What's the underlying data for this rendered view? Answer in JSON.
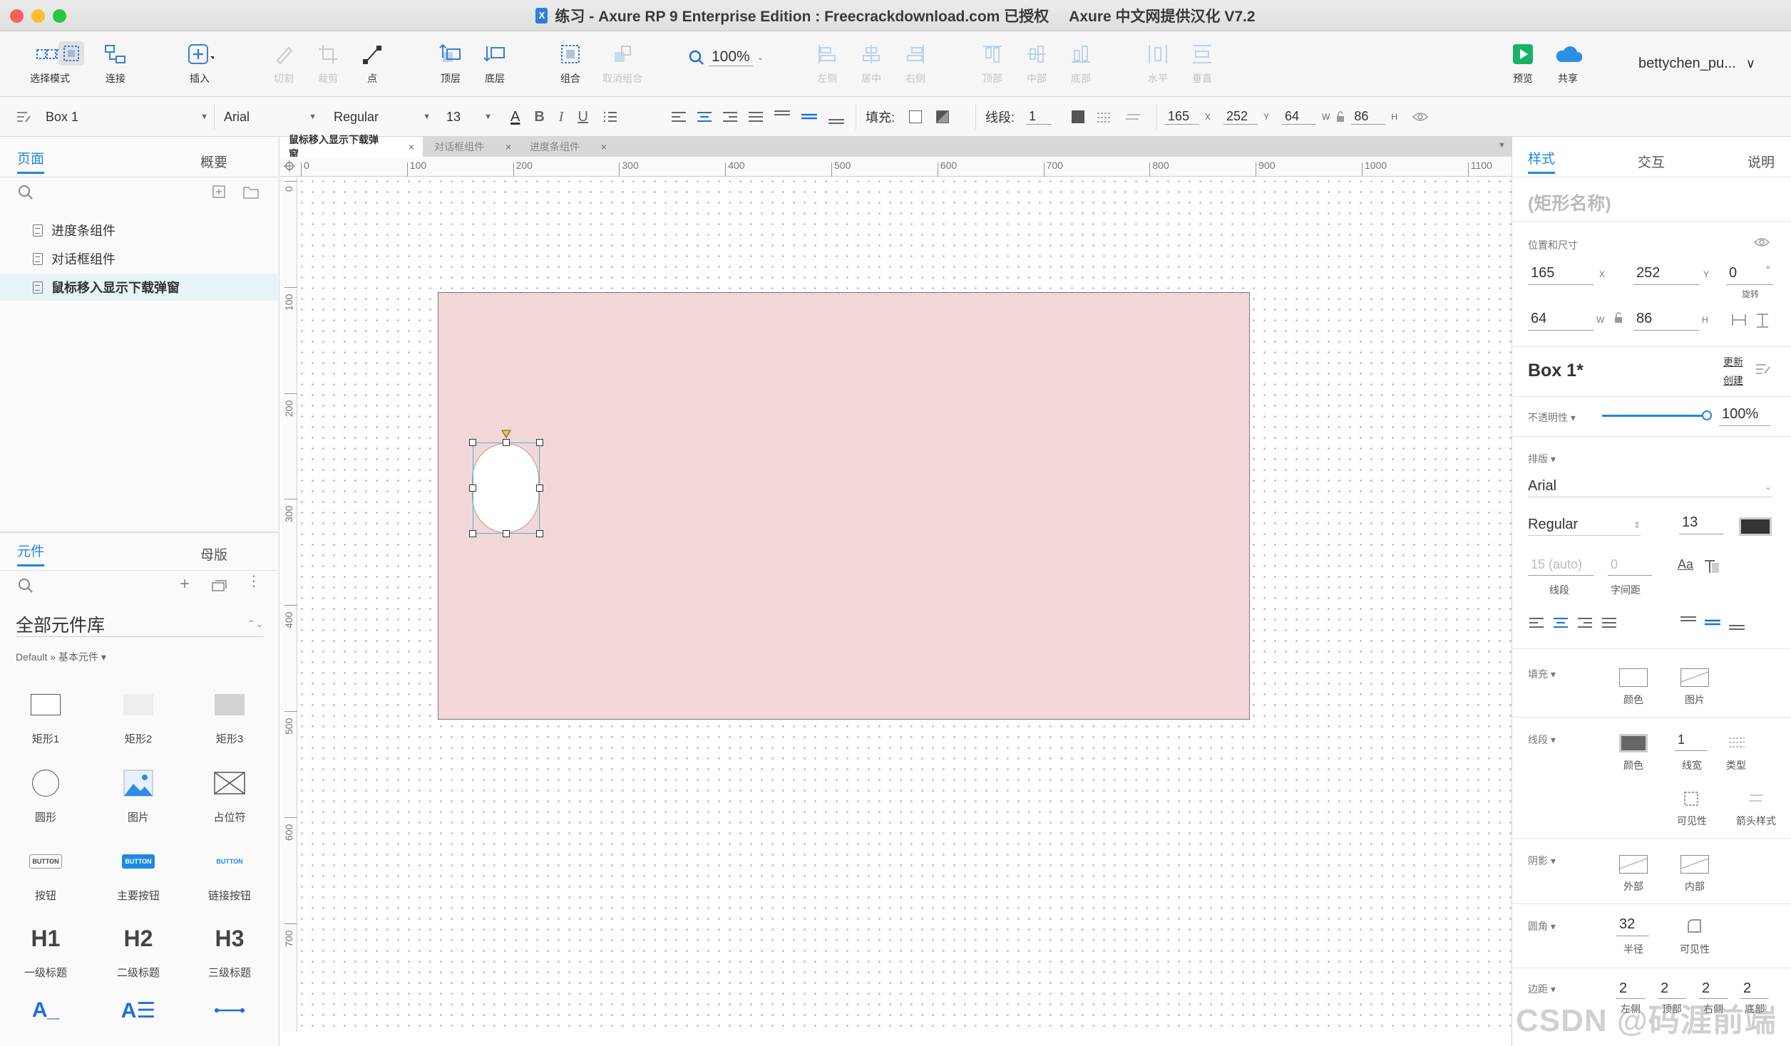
{
  "window": {
    "title": "练习 - Axure RP 9 Enterprise Edition : Freecrackdownload.com 已授权",
    "title_suffix": "Axure 中文网提供汉化 V7.2",
    "badge": "X"
  },
  "toolbar": {
    "select_mode": "选择模式",
    "connect": "连接",
    "insert": "插入",
    "cut": "切割",
    "crop": "裁剪",
    "point": "点",
    "top": "顶层",
    "bottom": "底层",
    "group": "组合",
    "ungroup": "取消组合",
    "zoom": "100%",
    "align_left": "左侧",
    "align_center": "居中",
    "align_right": "右侧",
    "align_top": "顶部",
    "align_middle": "中部",
    "align_bottom": "底部",
    "dist_h": "水平",
    "dist_v": "垂直",
    "preview": "预览",
    "share": "共享",
    "user": "bettychen_pu..."
  },
  "formatbar": {
    "widget_name": "Box 1",
    "font": "Arial",
    "weight": "Regular",
    "size": "13",
    "fill_label": "填充:",
    "stroke_label": "线段:",
    "stroke_width": "1",
    "x": "165",
    "y": "252",
    "w": "64",
    "h": "86",
    "x_unit": "X",
    "y_unit": "Y",
    "w_unit": "W",
    "h_unit": "H"
  },
  "left": {
    "tabs": [
      "页面",
      "概要"
    ],
    "pages": [
      "进度条组件",
      "对话框组件",
      "鼠标移入显示下载弹窗"
    ],
    "lib_tabs": [
      "元件",
      "母版"
    ],
    "library": "全部元件库",
    "library_sub": "Default » 基本元件 ▾",
    "widgets": [
      "矩形1",
      "矩形2",
      "矩形3",
      "圆形",
      "图片",
      "占位符",
      "按钮",
      "主要按钮",
      "链接按钮",
      "一级标题",
      "二级标题",
      "三级标题"
    ],
    "button_text": "BUTTON",
    "headings": [
      "H1",
      "H2",
      "H3"
    ],
    "text_icons": [
      "A_",
      "A☰"
    ]
  },
  "canvas": {
    "doc_tabs": [
      "鼠标移入显示下载弹窗",
      "对话框组件",
      "进度条组件"
    ],
    "h_ticks": [
      "0",
      "100",
      "200",
      "300",
      "400",
      "500",
      "600",
      "700",
      "800",
      "900",
      "1000",
      "1100"
    ],
    "v_ticks": [
      "0",
      "100",
      "200",
      "300",
      "400",
      "500",
      "600",
      "700"
    ],
    "colors": {
      "box_fill": "#f3d6d8",
      "grid_dot": "#8b8ef0",
      "selection": "#3cc0c8"
    }
  },
  "right": {
    "tabs": [
      "样式",
      "交互",
      "说明"
    ],
    "shape_name_placeholder": "(矩形名称)",
    "pos_size_label": "位置和尺寸",
    "x": "165",
    "y": "252",
    "rotation": "0",
    "rotation_unit": "°",
    "rotation_label": "旋转",
    "w": "64",
    "h": "86",
    "x_unit": "X",
    "y_unit": "Y",
    "w_unit": "W",
    "h_unit": "H",
    "style_name": "Box 1*",
    "update": "更新",
    "create": "创建",
    "opacity_label": "不透明性 ▾",
    "opacity": "100%",
    "typography_label": "排版 ▾",
    "font": "Arial",
    "weight": "Regular",
    "size": "13",
    "line_height": "15 (auto)",
    "line_height_label": "线段",
    "letter_spacing": "0",
    "letter_spacing_label": "字间距",
    "text_case": "Aa",
    "fill_label": "填充 ▾",
    "fill_color": "颜色",
    "fill_image": "图片",
    "stroke_label": "线段 ▾",
    "stroke_color": "颜色",
    "stroke_width": "1",
    "stroke_width_label": "线宽",
    "stroke_type": "类型",
    "visibility": "可见性",
    "arrow_style": "箭头样式",
    "shadow_label": "阴影 ▾",
    "shadow_outer": "外部",
    "shadow_inner": "内部",
    "corner_label": "圆角 ▾",
    "corner_radius": "32",
    "corner_radius_label": "半径",
    "corner_visibility": "可见性",
    "padding_label": "边距 ▾",
    "padding": [
      "2",
      "2",
      "2",
      "2"
    ],
    "padding_labels": [
      "左侧",
      "顶部",
      "右侧",
      "底部"
    ]
  },
  "watermark": "CSDN @码涯前端"
}
